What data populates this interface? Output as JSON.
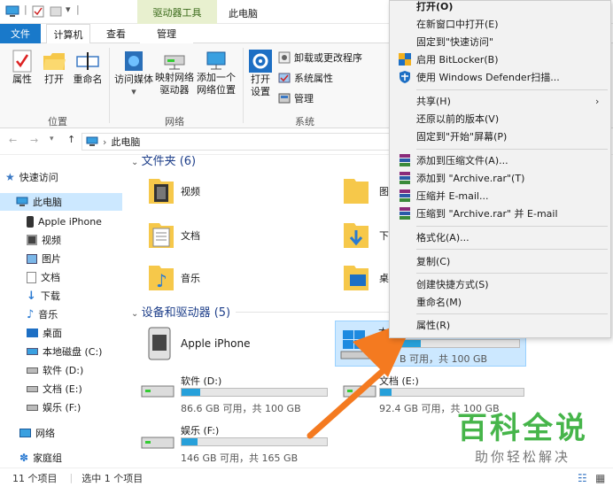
{
  "titlebar": {
    "context_tab": "驱动器工具",
    "window_title": "此电脑"
  },
  "tabs": {
    "file": "文件",
    "computer": "计算机",
    "view": "查看",
    "manage": "管理"
  },
  "ribbon": {
    "properties": "属性",
    "open": "打开",
    "rename": "重命名",
    "access_media": "访问媒体",
    "map_drive_1": "映射网络",
    "map_drive_2": "驱动器",
    "add_location_1": "添加一个",
    "add_location_2": "网络位置",
    "open_settings_1": "打开",
    "open_settings_2": "设置",
    "uninstall": "卸载或更改程序",
    "system_props": "系统属性",
    "manage": "管理",
    "group_location": "位置",
    "group_network": "网络",
    "group_system": "系统"
  },
  "address": {
    "path": "此电脑"
  },
  "nav": {
    "quick_access": "快速访问",
    "this_pc": "此电脑",
    "iphone": "Apple iPhone",
    "videos": "视频",
    "pictures": "图片",
    "documents": "文档",
    "downloads": "下载",
    "music": "音乐",
    "desktop": "桌面",
    "drive_c": "本地磁盘 (C:)",
    "drive_d": "软件 (D:)",
    "drive_e": "文档 (E:)",
    "drive_f": "娱乐 (F:)",
    "network": "网络",
    "homegroup": "家庭组"
  },
  "content": {
    "folders_header": "文件夹 (6)",
    "devices_header": "设备和驱动器 (5)",
    "folder_videos": "视频",
    "folder_pictures": "图",
    "folder_documents": "文档",
    "folder_downloads": "下",
    "folder_music": "音乐",
    "folder_desktop": "桌",
    "iphone": "Apple iPhone",
    "drive_c_label": "本",
    "drive_c_free": "B 可用，共 100 GB",
    "drive_d_label": "软件 (D:)",
    "drive_d_free": "86.6 GB 可用，共 100 GB",
    "drive_e_label": "文档 (E:)",
    "drive_e_free": "92.4 GB 可用，共 100 GB",
    "drive_f_label": "娱乐 (F:)",
    "drive_f_free": "146 GB 可用，共 165 GB"
  },
  "drive_fill": {
    "c": 0.3,
    "d": 0.13,
    "e": 0.08,
    "f": 0.11
  },
  "status": {
    "count": "11 个项目",
    "selected": "选中 1 个项目"
  },
  "menu": {
    "open": "打开(O)",
    "open_new": "在新窗口中打开(E)",
    "pin_quick": "固定到\"快速访问\"",
    "bitlocker": "启用 BitLocker(B)",
    "defender": "使用 Windows Defender扫描...",
    "share": "共享(H)",
    "restore": "还原以前的版本(V)",
    "pin_start": "固定到\"开始\"屏幕(P)",
    "add_archive": "添加到压缩文件(A)...",
    "add_rar": "添加到 \"Archive.rar\"(T)",
    "compress_email": "压缩并 E-mail...",
    "compress_rar_email": "压缩到 \"Archive.rar\" 并 E-mail",
    "format": "格式化(A)...",
    "copy": "复制(C)",
    "create_shortcut": "创建快捷方式(S)",
    "rename": "重命名(M)",
    "properties": "属性(R)"
  },
  "watermark": {
    "title": "百科全说",
    "subtitle": "助你轻松解决"
  },
  "colors": {
    "accent": "#1979ca",
    "arrow": "#f47a20",
    "watermark": "#46b54a"
  }
}
